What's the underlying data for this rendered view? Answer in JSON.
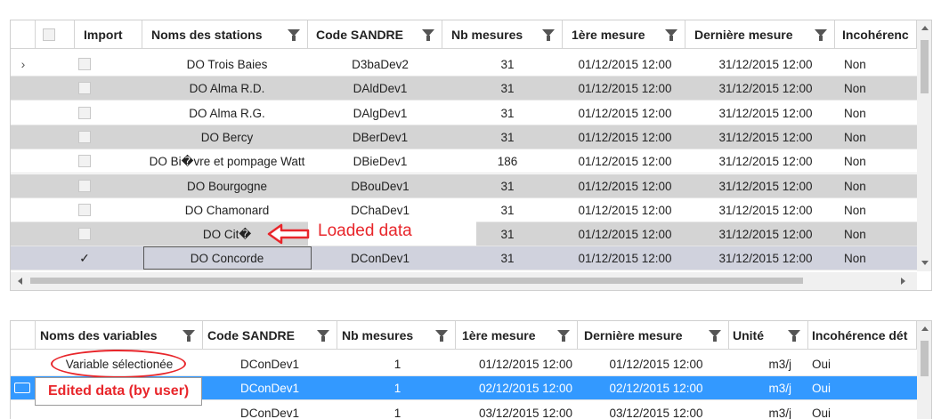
{
  "stations_grid": {
    "columns": [
      "Import",
      "Noms des stations",
      "Code SANDRE",
      "Nb mesures",
      "1ère mesure",
      "Dernière mesure",
      "Incohérenc"
    ],
    "rows": [
      {
        "checked": false,
        "name": "DO Trois Baies",
        "code": "D3baDev2",
        "nb": "31",
        "first": "01/12/2015 12:00",
        "last": "31/12/2015 12:00",
        "incoh": "Non"
      },
      {
        "checked": false,
        "name": "DO Alma R.D.",
        "code": "DAldDev1",
        "nb": "31",
        "first": "01/12/2015 12:00",
        "last": "31/12/2015 12:00",
        "incoh": "Non"
      },
      {
        "checked": false,
        "name": "DO Alma R.G.",
        "code": "DAlgDev1",
        "nb": "31",
        "first": "01/12/2015 12:00",
        "last": "31/12/2015 12:00",
        "incoh": "Non"
      },
      {
        "checked": false,
        "name": "DO Bercy",
        "code": "DBerDev1",
        "nb": "31",
        "first": "01/12/2015 12:00",
        "last": "31/12/2015 12:00",
        "incoh": "Non"
      },
      {
        "checked": false,
        "name": "DO Bi�vre et pompage Watt",
        "code": "DBieDev1",
        "nb": "186",
        "first": "01/12/2015 12:00",
        "last": "31/12/2015 12:00",
        "incoh": "Non"
      },
      {
        "checked": false,
        "name": "DO Bourgogne",
        "code": "DBouDev1",
        "nb": "31",
        "first": "01/12/2015 12:00",
        "last": "31/12/2015 12:00",
        "incoh": "Non"
      },
      {
        "checked": false,
        "name": "DO Chamonard",
        "code": "DChaDev1",
        "nb": "31",
        "first": "01/12/2015 12:00",
        "last": "31/12/2015 12:00",
        "incoh": "Non"
      },
      {
        "checked": false,
        "name": "DO Cit�",
        "code": "",
        "nb": "31",
        "first": "01/12/2015 12:00",
        "last": "31/12/2015 12:00",
        "incoh": "Non"
      },
      {
        "checked": true,
        "name": "DO Concorde",
        "code": "DConDev1",
        "nb": "31",
        "first": "01/12/2015 12:00",
        "last": "31/12/2015 12:00",
        "incoh": "Non"
      }
    ]
  },
  "variables_grid": {
    "columns": [
      "Noms des variables",
      "Code SANDRE",
      "Nb mesures",
      "1ère mesure",
      "Dernière mesure",
      "Unité",
      "Incohérence dét"
    ],
    "rows": [
      {
        "name": "Variable sélectionée",
        "code": "DConDev1",
        "nb": "1",
        "first": "01/12/2015 12:00",
        "last": "01/12/2015 12:00",
        "unit": "m3/j",
        "incoh": "Oui"
      },
      {
        "name": "",
        "code": "DConDev1",
        "nb": "1",
        "first": "02/12/2015 12:00",
        "last": "02/12/2015 12:00",
        "unit": "m3/j",
        "incoh": "Oui"
      },
      {
        "name": "",
        "code": "DConDev1",
        "nb": "1",
        "first": "03/12/2015 12:00",
        "last": "03/12/2015 12:00",
        "unit": "m3/j",
        "incoh": "Oui"
      }
    ]
  },
  "annotations": {
    "loaded": "Loaded data",
    "edited": "Edited data (by user)"
  },
  "colors": {
    "annotation": "#e8262b",
    "selected_row": "#3399ff"
  }
}
